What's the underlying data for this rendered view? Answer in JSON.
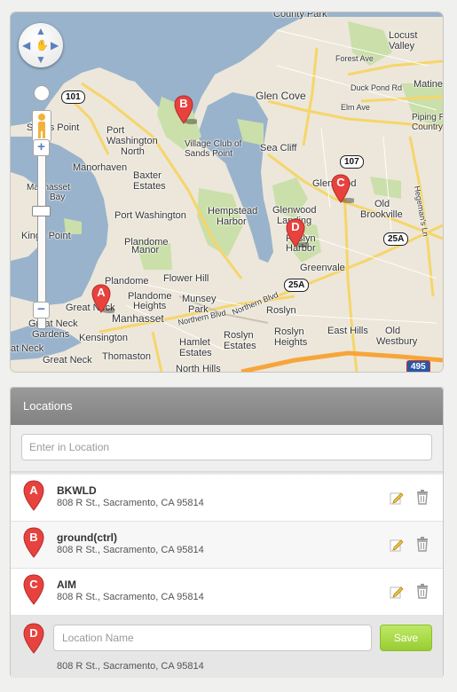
{
  "map": {
    "labels": [
      {
        "text": "County Park",
        "id": "county-park"
      },
      {
        "text": "Locust",
        "id": "locust"
      },
      {
        "text": "Valley",
        "id": "valley"
      },
      {
        "text": "Forest Ave",
        "id": "forest-ave"
      },
      {
        "text": "Duck Pond Rd",
        "id": "duck-pond-rd"
      },
      {
        "text": "Matine",
        "id": "matine"
      },
      {
        "text": "Elm Ave",
        "id": "elm-ave"
      },
      {
        "text": "Piping R",
        "id": "piping"
      },
      {
        "text": "Country",
        "id": "country"
      },
      {
        "text": "Glen Cove",
        "id": "glen-cove"
      },
      {
        "text": "Sea Cliff",
        "id": "sea-cliff"
      },
      {
        "text": "Glenwood",
        "id": "glenwood"
      },
      {
        "text": "Landing",
        "id": "landing"
      },
      {
        "text": "Glenwood",
        "id": "glenwood-head"
      },
      {
        "text": "Old",
        "id": "old1"
      },
      {
        "text": "Brookville",
        "id": "brookville"
      },
      {
        "text": "Roslyn",
        "id": "roslyn-h"
      },
      {
        "text": "Harbor",
        "id": "harbor"
      },
      {
        "text": "Greenvale",
        "id": "greenvale"
      },
      {
        "text": "Roslyn",
        "id": "roslyn"
      },
      {
        "text": "Roslyn",
        "id": "roslyn-e"
      },
      {
        "text": "Estates",
        "id": "estates-r"
      },
      {
        "text": "Roslyn",
        "id": "roslyn-hts"
      },
      {
        "text": "Heights",
        "id": "heights"
      },
      {
        "text": "East Hills",
        "id": "east-hills"
      },
      {
        "text": "Old",
        "id": "old2"
      },
      {
        "text": "Westbury",
        "id": "westbury"
      },
      {
        "text": "Hempstead",
        "id": "hempstead"
      },
      {
        "text": "Harbor",
        "id": "harbor2"
      },
      {
        "text": "Sands Point",
        "id": "sands-point"
      },
      {
        "text": "Port",
        "id": "port1"
      },
      {
        "text": "Washington",
        "id": "washington1"
      },
      {
        "text": "North",
        "id": "north"
      },
      {
        "text": "Manorhaven",
        "id": "manorhaven"
      },
      {
        "text": "Baxter",
        "id": "baxter"
      },
      {
        "text": "Estates",
        "id": "estates-b"
      },
      {
        "text": "Manhasset",
        "id": "manhasset-bay1"
      },
      {
        "text": "Bay",
        "id": "bay"
      },
      {
        "text": "Port Washington",
        "id": "port-washington"
      },
      {
        "text": "Kings Point",
        "id": "kings-point"
      },
      {
        "text": "Plandome",
        "id": "plandome1"
      },
      {
        "text": "Manor",
        "id": "manor"
      },
      {
        "text": "Plandome",
        "id": "plandome2"
      },
      {
        "text": "Flower Hill",
        "id": "flower-hill"
      },
      {
        "text": "Plandome",
        "id": "plandome3"
      },
      {
        "text": "Heights",
        "id": "heights2"
      },
      {
        "text": "Munsey",
        "id": "munsey"
      },
      {
        "text": "Park",
        "id": "park"
      },
      {
        "text": "Great Neck",
        "id": "great-neck"
      },
      {
        "text": "Manhasset",
        "id": "manhasset"
      },
      {
        "text": "Great Neck",
        "id": "great-neck2"
      },
      {
        "text": "Gardens",
        "id": "gardens"
      },
      {
        "text": "Kensington",
        "id": "kensington"
      },
      {
        "text": "Thomaston",
        "id": "thomaston"
      },
      {
        "text": "Hamlet",
        "id": "hamlet"
      },
      {
        "text": "Estates",
        "id": "estates-h"
      },
      {
        "text": "North Hills",
        "id": "north-hills"
      },
      {
        "text": "Great Neck",
        "id": "great-neck3"
      },
      {
        "text": "at Neck",
        "id": "at-neck"
      },
      {
        "text": "Village Club of",
        "id": "village-club"
      },
      {
        "text": "Sands Point",
        "id": "village-club2"
      },
      {
        "text": "Northern Blvd",
        "id": "northern-blvd1"
      },
      {
        "text": "Northern Blvd",
        "id": "northern-blvd2"
      },
      {
        "text": "Hegeman's Ln",
        "id": "hegemans"
      }
    ],
    "shields": [
      "101",
      "107",
      "25A",
      "25A",
      "495"
    ],
    "markers": [
      "A",
      "B",
      "C",
      "D"
    ],
    "zoom_in": "+",
    "zoom_out": "−"
  },
  "panel": {
    "title": "Locations",
    "search_placeholder": "Enter in Location",
    "locations": [
      {
        "letter": "A",
        "name": "BKWLD",
        "address": "808 R St., Sacramento, CA 95814"
      },
      {
        "letter": "B",
        "name": "ground(ctrl)",
        "address": "808 R St., Sacramento, CA 95814"
      },
      {
        "letter": "C",
        "name": "AIM",
        "address": "808 R St., Sacramento, CA 95814"
      }
    ],
    "new_location": {
      "letter": "D",
      "placeholder": "Location Name",
      "address": "808 R St., Sacramento, CA 95814",
      "save_label": "Save"
    }
  },
  "colors": {
    "marker": "#e8423e",
    "save": "#a6d73f",
    "header": "#8f8f8f",
    "water": "#99b3cc",
    "park": "#cadfaa"
  }
}
